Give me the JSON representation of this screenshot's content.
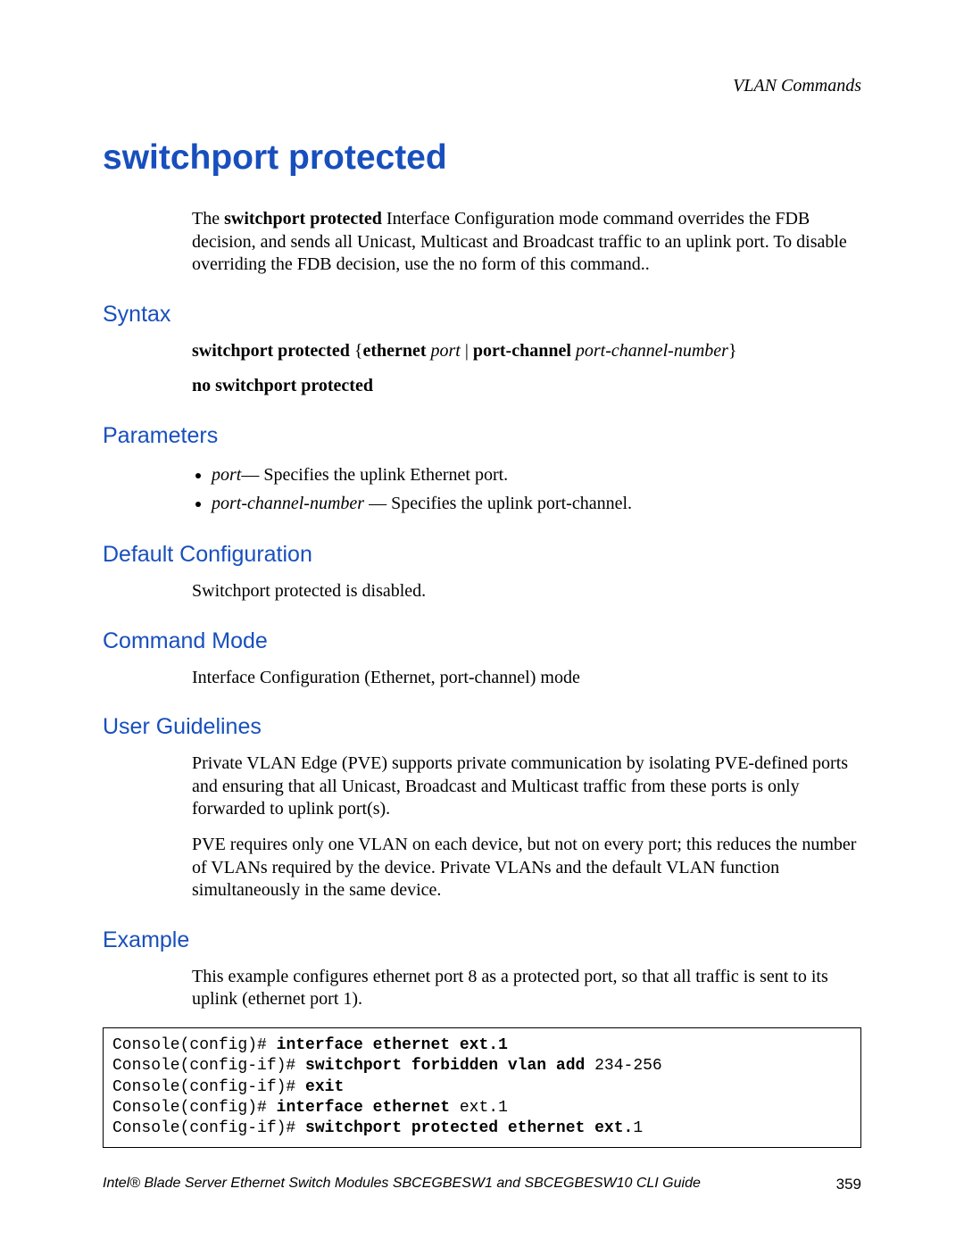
{
  "running_header": "VLAN Commands",
  "title": "switchport protected",
  "intro_parts": {
    "pre": "The ",
    "bold": "switchport protected",
    "post": " Interface Configuration mode command overrides the FDB decision, and sends all Unicast, Multicast and Broadcast traffic to an uplink port. To disable overriding the FDB decision, use the no form of this command.."
  },
  "sections": {
    "syntax": {
      "heading": "Syntax",
      "line1": {
        "a": "switchport protected",
        "b": " {",
        "c": "ethernet",
        "d": " ",
        "e": "port",
        "f": " | ",
        "g": "port-channel",
        "h": " ",
        "i": "port-channel-number",
        "j": "}"
      },
      "line2": "no switchport protected"
    },
    "parameters": {
      "heading": "Parameters",
      "items": [
        {
          "term": "port",
          "desc": "— Specifies the uplink Ethernet port."
        },
        {
          "term": "port-channel-number",
          "desc": " — Specifies the uplink port-channel."
        }
      ]
    },
    "default_config": {
      "heading": "Default Configuration",
      "text": "Switchport protected is disabled."
    },
    "command_mode": {
      "heading": "Command Mode",
      "text": "Interface Configuration (Ethernet, port-channel) mode"
    },
    "user_guidelines": {
      "heading": "User Guidelines",
      "p1": "Private VLAN Edge (PVE) supports private communication by isolating PVE-defined ports and ensuring that all Unicast, Broadcast and Multicast traffic from these ports is only forwarded to uplink port(s).",
      "p2": "PVE requires only one VLAN on each device, but not on every port; this reduces the number of VLANs required by the device. Private VLANs and the default VLAN function simultaneously in the same device."
    },
    "example": {
      "heading": "Example",
      "intro": "This example configures ethernet port 8 as a protected port, so that all traffic is sent to its uplink (ethernet port 1).",
      "code": {
        "l1a": "Console(config)# ",
        "l1b": "interface ethernet ext.1",
        "l2a": "Console(config-if)# ",
        "l2b": "switchport forbidden vlan add ",
        "l2c": "234-256",
        "l3a": "Console(config-if)# ",
        "l3b": "exit",
        "l4a": "Console(config)# ",
        "l4b": "interface ethernet ",
        "l4c": "ext.1",
        "l5a": "Console(config-if)# ",
        "l5b": "switchport protected ethernet ext.",
        "l5c": "1"
      }
    }
  },
  "footer": {
    "left": "Intel® Blade Server Ethernet Switch Modules SBCEGBESW1 and SBCEGBESW10 CLI Guide",
    "page": "359"
  }
}
